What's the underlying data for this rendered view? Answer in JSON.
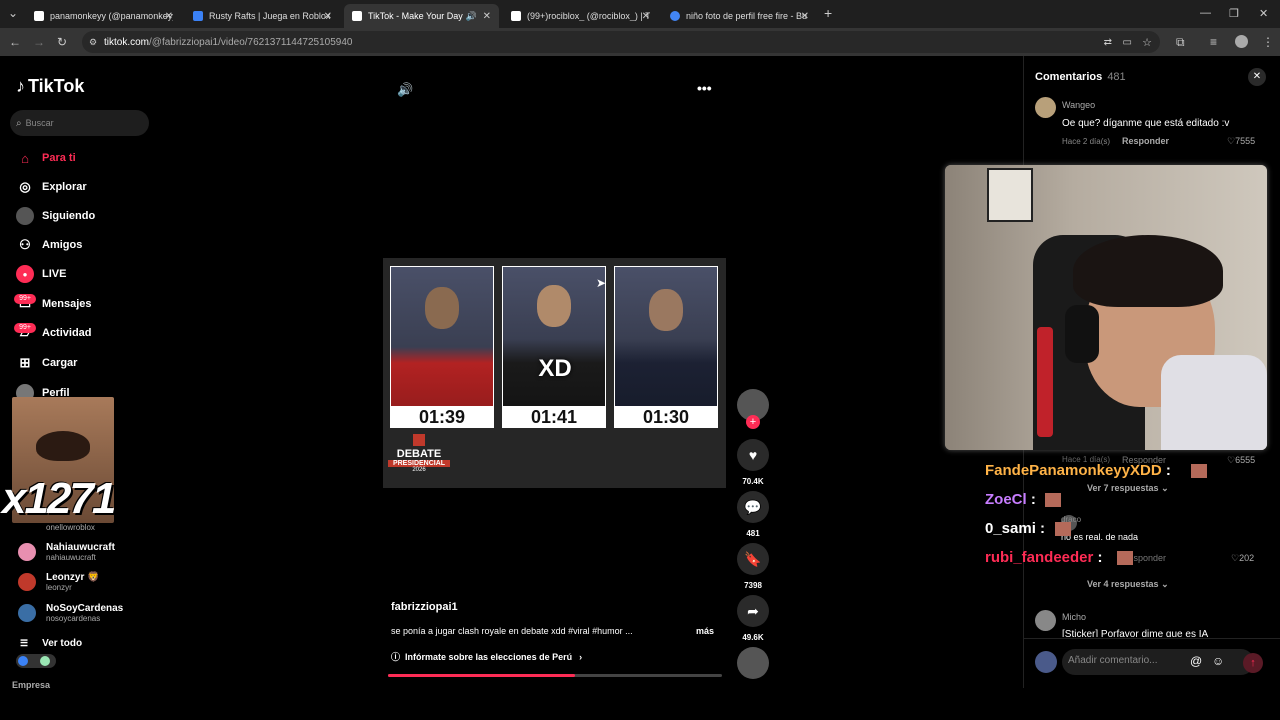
{
  "tabs": [
    {
      "label": "panamonkeyy (@panamonkeyy",
      "active": false
    },
    {
      "label": "Rusty Rafts | Juega en Roblox",
      "active": false
    },
    {
      "label": "TikTok - Make Your Day",
      "active": true
    },
    {
      "label": "(99+)rociblox_ (@rociblox_) | Ti",
      "active": false
    },
    {
      "label": "niño foto de perfil free fire - Bu",
      "active": false
    }
  ],
  "url": {
    "host": "tiktok.com",
    "path": "/@fabrizziopai1/video/7621371144725105940"
  },
  "sidebar": {
    "logo": "TikTok",
    "search_placeholder": "Buscar",
    "nav": [
      "Para ti",
      "Explorar",
      "Siguiendo",
      "Amigos",
      "LIVE",
      "Mensajes",
      "Actividad",
      "Cargar",
      "Perfil"
    ],
    "badge": "99+",
    "accounts": [
      {
        "name": "",
        "handle": "onellowroblox"
      },
      {
        "name": "Nahiauwucraft",
        "handle": "nahiauwucraft"
      },
      {
        "name": "Leonzyr 🦁",
        "handle": "leonzyr"
      },
      {
        "name": "NoSoyCardenas",
        "handle": "nosoycardenas"
      }
    ],
    "see_all": "Ver todo",
    "footer": "Empresa"
  },
  "overlay_counter": "x1271",
  "video": {
    "timers": [
      "01:39",
      "01:41",
      "01:30"
    ],
    "center_text": "XD",
    "debate_title": "DEBATE",
    "debate_sub": "PRESIDENCIAL",
    "debate_year": "2026",
    "author": "fabrizziopai1",
    "caption": "se ponía a jugar clash royale en debate xdd #viral #humor ...",
    "more": "más",
    "info_link": "Infórmate sobre las elecciones de Perú",
    "progress": 0.56
  },
  "actions": {
    "likes": "70.4K",
    "comments": "481",
    "saves": "7398",
    "shares": "49.6K"
  },
  "comments": {
    "title": "Comentarios",
    "count": "481",
    "first": {
      "user": "Wangeo",
      "text": "Oe que? díganme que está editado :v",
      "time": "Hace 2 día(s)",
      "reply": "Responder",
      "likes": "7555"
    },
    "hidden_time": "Hace 1 día(s)",
    "hidden_reply": "Responder",
    "hidden_likes": "6555",
    "see_replies_7": "Ver 7 respuestas",
    "reply_user": "draco",
    "reply_text": "no es real. de nada",
    "reply_action": "Responder",
    "reply_likes": "202",
    "see_replies_4": "Ver 4 respuestas",
    "last_user": "Micho",
    "last_text": "[Sticker] Porfavor dime que es IA",
    "input_placeholder": "Añadir comentario..."
  },
  "chat": [
    {
      "user": "FandePanamonkeyyXDD",
      "color": "#ffb347"
    },
    {
      "user": "ZoeCl",
      "color": "#c77dff"
    },
    {
      "user": "0_sami",
      "color": "#ffffff"
    },
    {
      "user": "rubi_fandeeder",
      "color": "#fe2c55"
    }
  ],
  "colors": {
    "accent": "#fe2c55",
    "bg": "#000000"
  }
}
